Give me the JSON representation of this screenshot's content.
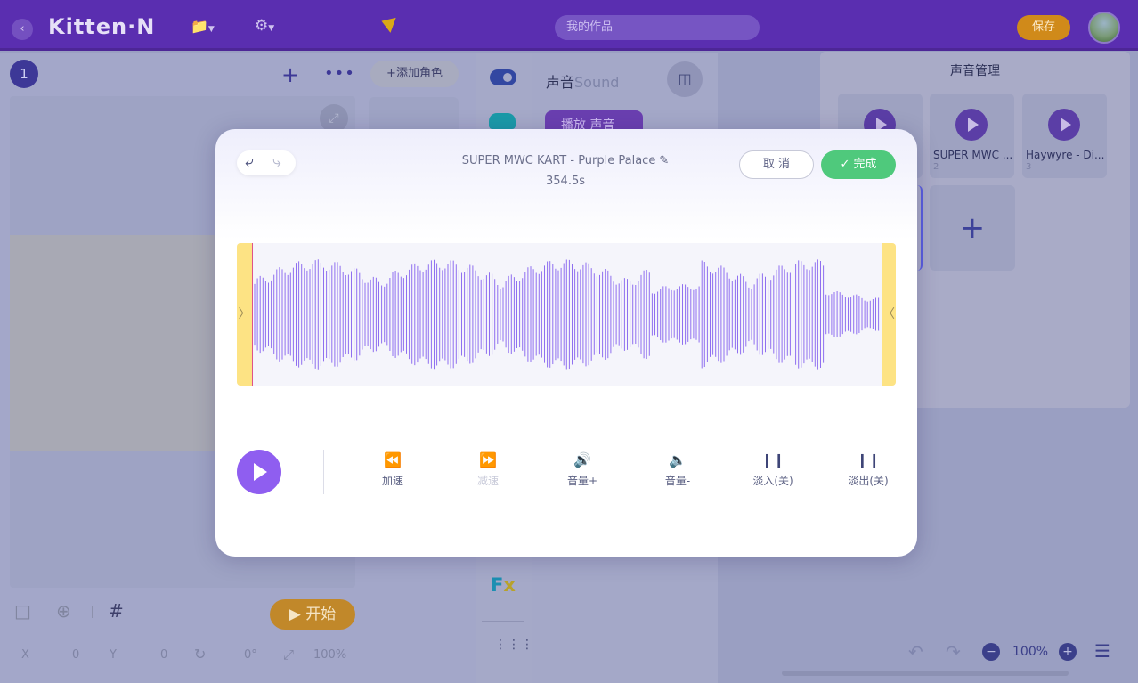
{
  "topbar": {
    "back_icon": "chevron-left-icon",
    "logo": "Kitten·N",
    "search_placeholder": "我的作品",
    "save_label": "保存"
  },
  "stage_panel": {
    "scene_number": "1",
    "add_role_label": "+添加角色",
    "start_label": "开始",
    "coords": {
      "x_label": "X",
      "x_value": "0",
      "y_label": "Y",
      "y_value": "0",
      "rotation": "0°",
      "scale": "100%"
    }
  },
  "block_area": {
    "title": "声音",
    "title_en": "Sound",
    "play_block_label": "播放 声音"
  },
  "sound_manager": {
    "title": "声音管理",
    "items": [
      {
        "name": "",
        "number": ""
      },
      {
        "name": "SUPER MWC ...",
        "number": "2"
      },
      {
        "name": "Haywyre - Di...",
        "number": "3"
      }
    ]
  },
  "workspace": {
    "zoom": "100%"
  },
  "editor_modal": {
    "track_title": "SUPER MWC KART - Purple Palace",
    "duration": "354.5s",
    "cancel_label": "取 消",
    "done_label": "完成",
    "controls": [
      {
        "label": "加速",
        "icon": "fast-forward-icon",
        "disabled": false
      },
      {
        "label": "减速",
        "icon": "slow-down-icon",
        "disabled": true
      },
      {
        "label": "音量+",
        "icon": "volume-up-icon",
        "disabled": false
      },
      {
        "label": "音量-",
        "icon": "volume-down-icon",
        "disabled": false
      },
      {
        "label": "淡入(关)",
        "icon": "fade-in-icon",
        "disabled": false
      },
      {
        "label": "淡出(关)",
        "icon": "fade-out-icon",
        "disabled": false
      }
    ],
    "colors": {
      "waveform": "#8f6ff0",
      "trim_handle": "#fde384",
      "done_button": "#4fc97c",
      "play_button": "#8f5ef0"
    }
  }
}
